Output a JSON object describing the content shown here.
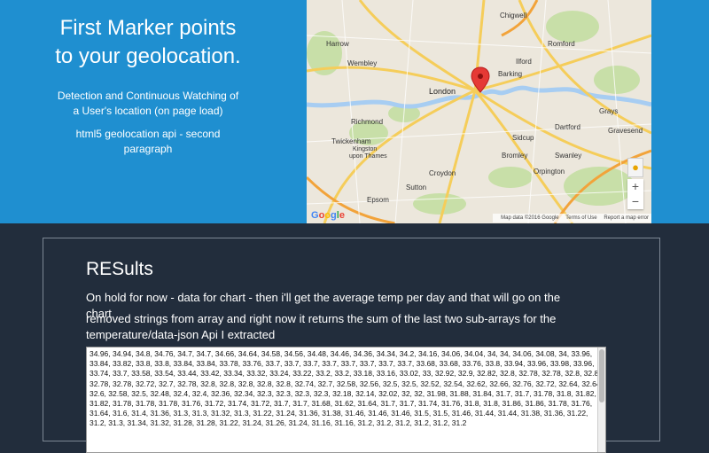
{
  "hero": {
    "title_line1": "First Marker points",
    "title_line2": "to your geolocation.",
    "desc_line1": "Detection and Continuous Watching of",
    "desc_line2": "a User's location (on page load)",
    "para_line1": "html5 geolocation api - second",
    "para_line2": "paragraph"
  },
  "map": {
    "labels": {
      "harrow": "Harrow",
      "wembley": "Wembley",
      "london": "London",
      "richmond": "Richmond",
      "twickenham": "Twickenham",
      "kingston1": "Kingston",
      "kingston2": "upon Thames",
      "croydon": "Croydon",
      "bromley": "Bromley",
      "epsom": "Epsom",
      "sutton": "Sutton",
      "chigwell": "Chigwell",
      "romford": "Romford",
      "ilford": "Ilford",
      "barking": "Barking",
      "dartford": "Dartford",
      "sidcup": "Sidcup",
      "grays": "Grays",
      "gravesend": "Gravesend",
      "swanley": "Swanley",
      "orpington": "Orpington"
    },
    "google": "Google",
    "data_label": "Map data ©2016 Google",
    "terms": "Terms of Use",
    "report": "Report a map error",
    "zoom_in": "+",
    "zoom_out": "−",
    "colors": {
      "water": "#a7cdf2",
      "major_road": "#f5cd5a",
      "park": "#c8dfa8",
      "marker": "#e53935"
    }
  },
  "results": {
    "title": "RESults",
    "line1": "On hold for now - data for chart - then i'll get the average temp per day and that will go on the chart",
    "line2": "removed strings from array and right now it returns the sum of the last two sub-arrays for the temperature/data-json Api I extracted",
    "data_text": "34.96, 34.94, 34.8, 34.76, 34.7, 34.7, 34.66, 34.64, 34.58, 34.56, 34.48, 34.46, 34.36, 34.34, 34.2, 34.16, 34.06, 34.04, 34, 34, 34.06, 34.08, 34, 33.96, 33.84, 33.82, 33.8, 33.8, 33.84, 33.84, 33.78, 33.76, 33.7, 33.7, 33.7, 33.7, 33.7, 33.7, 33.7, 33.7, 33.68, 33.68, 33.76, 33.8, 33.94, 33.96, 33.98, 33.96, 33.74, 33.7, 33.58, 33.54, 33.44, 33.42, 33.34, 33.32, 33.24, 33.22, 33.2, 33.2, 33.18, 33.16, 33.02, 33, 32.92, 32.9, 32.82, 32.8, 32.78, 32.78, 32.8, 32.8, 32.78, 32.78, 32.72, 32.7, 32.78, 32.8, 32.8, 32.8, 32.8, 32.8, 32.74, 32.7, 32.58, 32.56, 32.5, 32.5, 32.52, 32.54, 32.62, 32.66, 32.76, 32.72, 32.64, 32.64, 32.6, 32.58, 32.5, 32.48, 32.4, 32.4, 32.36, 32.34, 32.3, 32.3, 32.3, 32.3, 32.18, 32.14, 32.02, 32, 32, 31.98, 31.88, 31.84, 31.7, 31.7, 31.78, 31.8, 31.82, 31.82, 31.78, 31.78, 31.78, 31.76, 31.72, 31.74, 31.72, 31.7, 31.7, 31.68, 31.62, 31.64, 31.7, 31.7, 31.74, 31.76, 31.8, 31.8, 31.86, 31.86, 31.78, 31.76, 31.64, 31.6, 31.4, 31.36, 31.3, 31.3, 31.32, 31.3, 31.22, 31.24, 31.36, 31.38, 31.46, 31.46, 31.46, 31.5, 31.5, 31.46, 31.44, 31.44, 31.38, 31.36, 31.22, 31.2, 31.3, 31.34, 31.32, 31.28, 31.28, 31.22, 31.24, 31.26, 31.24, 31.16, 31.16, 31.2, 31.2, 31.2, 31.2, 31.2, 31.2"
  }
}
